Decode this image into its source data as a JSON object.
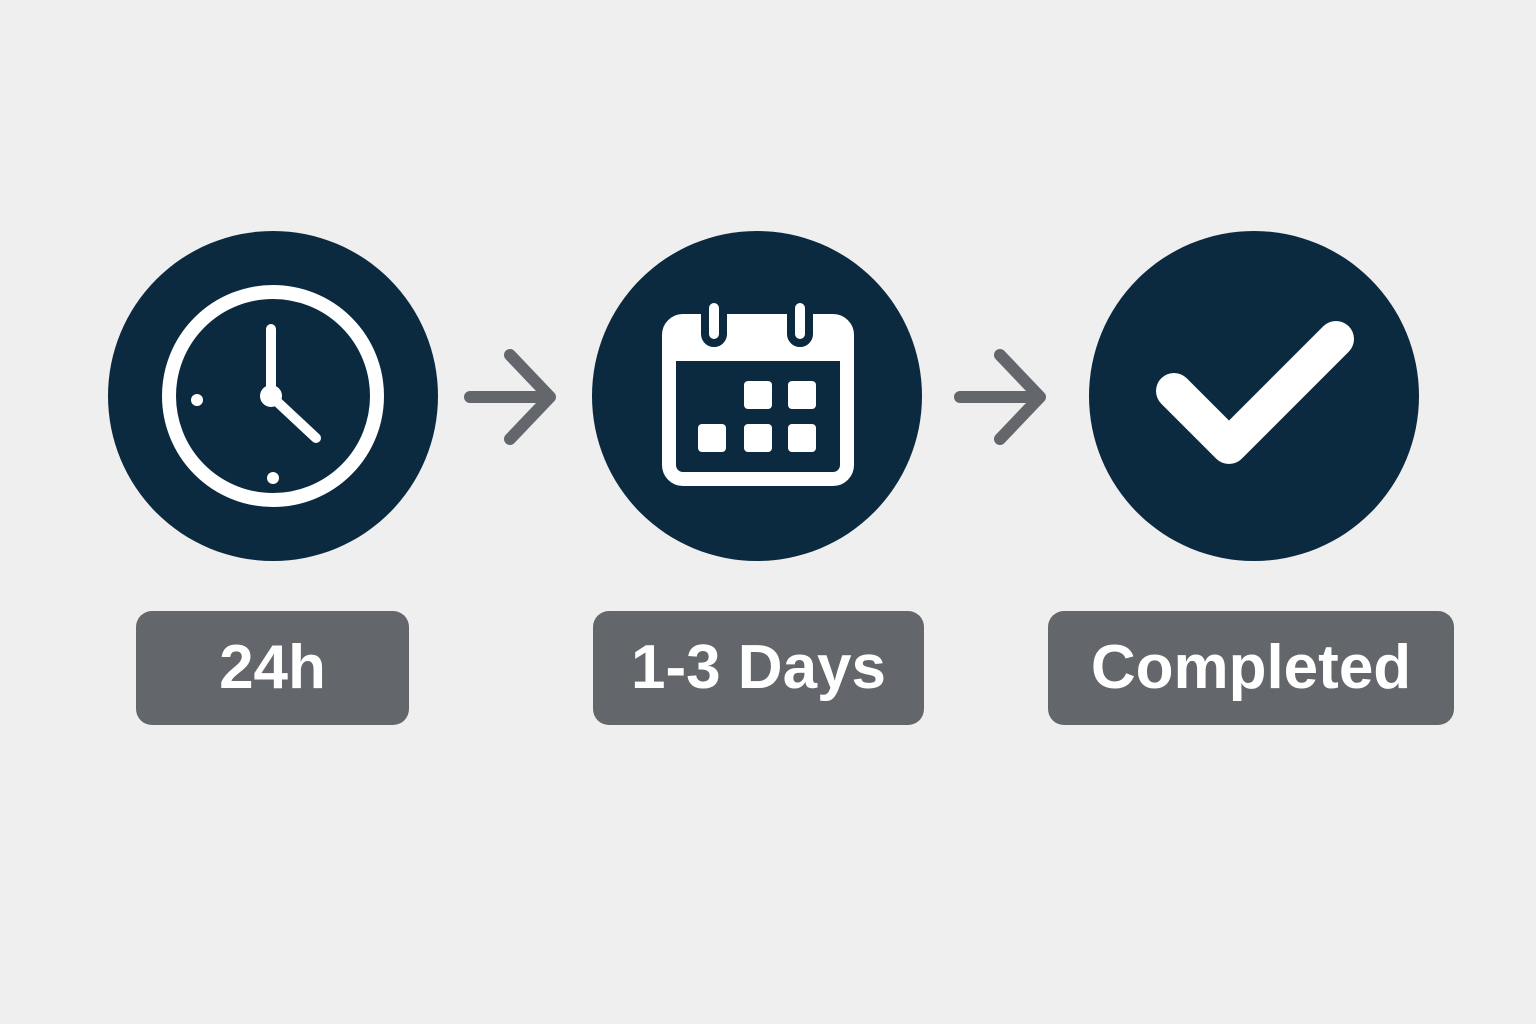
{
  "colors": {
    "background": "#efefef",
    "circle": "#0b2a40",
    "icon": "#ffffff",
    "arrow": "#63666a",
    "label_bg": "#63666a",
    "label_text": "#ffffff"
  },
  "steps": [
    {
      "icon": "clock-icon",
      "label": "24h"
    },
    {
      "icon": "calendar-icon",
      "label": "1-3 Days"
    },
    {
      "icon": "checkmark-icon",
      "label": "Completed"
    }
  ],
  "connectors": [
    {
      "icon": "arrow-right-icon"
    },
    {
      "icon": "arrow-right-icon"
    }
  ]
}
